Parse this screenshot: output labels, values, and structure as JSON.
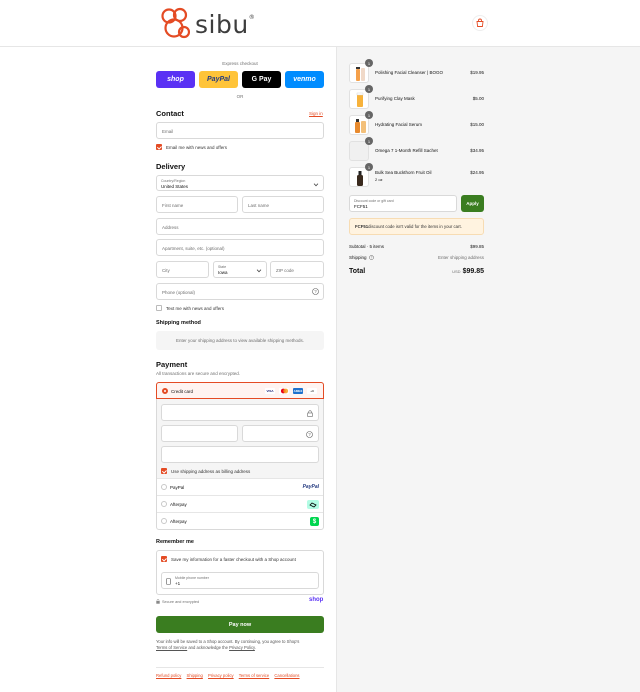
{
  "header": {
    "brand": "sibu",
    "brand_mark": "®"
  },
  "express": {
    "title": "Express checkout",
    "or": "OR",
    "shop_label": "shop",
    "paypal_label": "PayPal",
    "gpay_label": "G Pay",
    "venmo_label": "venmo"
  },
  "contact": {
    "heading": "Contact",
    "signin": "Sign in",
    "email_placeholder": "Email",
    "news_label": "Email me with news and offers"
  },
  "delivery": {
    "heading": "Delivery",
    "country_label": "Country/Region",
    "country_value": "United States",
    "first_name": "First name",
    "last_name": "Last name",
    "address": "Address",
    "apartment": "Apartment, suite, etc. (optional)",
    "city": "City",
    "state_label": "State",
    "state_value": "Iowa",
    "zip": "ZIP code",
    "phone": "Phone (optional)",
    "text_label": "Text me with news and offers"
  },
  "shipping": {
    "heading": "Shipping method",
    "notice": "Enter your shipping address to view available shipping methods."
  },
  "payment": {
    "heading": "Payment",
    "subtitle": "All transactions are secure and encrypted.",
    "credit_card": "Credit card",
    "billing_label": "Use shipping address as billing address",
    "paypal": "PayPal",
    "afterpay1": "Afterpay",
    "afterpay2": "Afterpay",
    "card_brands": [
      "VISA",
      "MC",
      "AMEX",
      "+3"
    ],
    "paypal_logo": "PayPal"
  },
  "remember": {
    "heading": "Remember me",
    "save_label": "Save my information for a faster checkout with a Shop account",
    "mobile_label": "Mobile phone number",
    "mobile_value": "+1",
    "secure": "Secure and encrypted",
    "shop": "shop"
  },
  "pay_now": "Pay now",
  "legal": {
    "text1": "Your info will be saved to a Shop account. By continuing, you agree to Shop's",
    "terms": "Terms of Service",
    "text2": " and acknowledge the ",
    "privacy": "Privacy Policy",
    "dot": "."
  },
  "footer": [
    "Refund policy",
    "Shipping",
    "Privacy policy",
    "Terms of service",
    "Cancellations"
  ],
  "cart": {
    "items": [
      {
        "qty": "1",
        "name": "Polishing Facial Cleanser | BOGO",
        "variant": "",
        "price": "$19.95"
      },
      {
        "qty": "1",
        "name": "Purifying Clay Mask",
        "variant": "",
        "price": "$5.00"
      },
      {
        "qty": "1",
        "name": "Hydrating Facial Serum",
        "variant": "",
        "price": "$15.00"
      },
      {
        "qty": "1",
        "name": "Omega 7 1-Month Refill Sachet",
        "variant": "",
        "price": "$34.95"
      },
      {
        "qty": "1",
        "name": "Bulk Sea Buckthorn Fruit Oil",
        "variant": "2 oz",
        "price": "$24.95"
      }
    ],
    "discount_label": "Discount code or gift card",
    "discount_value": "FCF51",
    "apply": "Apply",
    "error_code": "FCF51",
    "error_text": " discount code isn't valid for the items in your cart.",
    "subtotal_label": "Subtotal · 5 items",
    "subtotal_value": "$99.85",
    "shipping_label": "Shipping",
    "shipping_value": "Enter shipping address",
    "total_label": "Total",
    "currency": "USD",
    "total_value": "$99.85"
  },
  "colors": {
    "accent": "#e44b24",
    "shop": "#5a31f4",
    "paypal": "#ffc439",
    "venmo": "#008cff",
    "pay": "#3a7d20"
  }
}
